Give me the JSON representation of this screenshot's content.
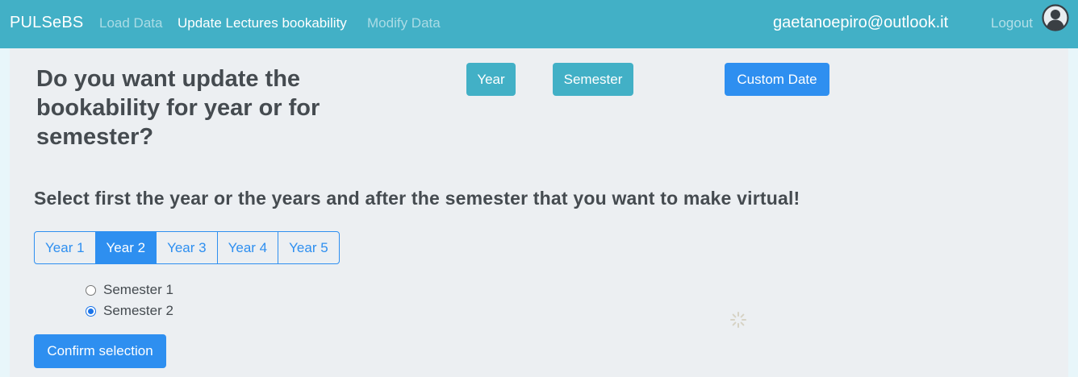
{
  "navbar": {
    "brand": "PULSeBS",
    "links": [
      "Load Data",
      "Update Lectures bookability",
      "Modify Data"
    ],
    "active_link": "Update Lectures bookability",
    "user_email": "gaetanoepiro@outlook.it",
    "logout_label": "Logout",
    "avatar_icon": "user-circle-icon"
  },
  "header": {
    "question": "Do you want update the bookability for year or for semester?",
    "buttons": {
      "year": "Year",
      "semester": "Semester",
      "custom_date": "Custom Date"
    }
  },
  "selection": {
    "instructions": "Select first the year or the years and after the semester that you want to make virtual!",
    "years": [
      "Year 1",
      "Year 2",
      "Year 3",
      "Year 4",
      "Year 5"
    ],
    "selected_year": "Year 2",
    "semesters": [
      "Semester 1",
      "Semester 2"
    ],
    "selected_semester": "Semester 2",
    "confirm_label": "Confirm selection"
  },
  "colors": {
    "navbar": "#42b0c6",
    "primary": "#2e8ff0",
    "info": "#42b0c6",
    "panel": "#eceff2"
  }
}
